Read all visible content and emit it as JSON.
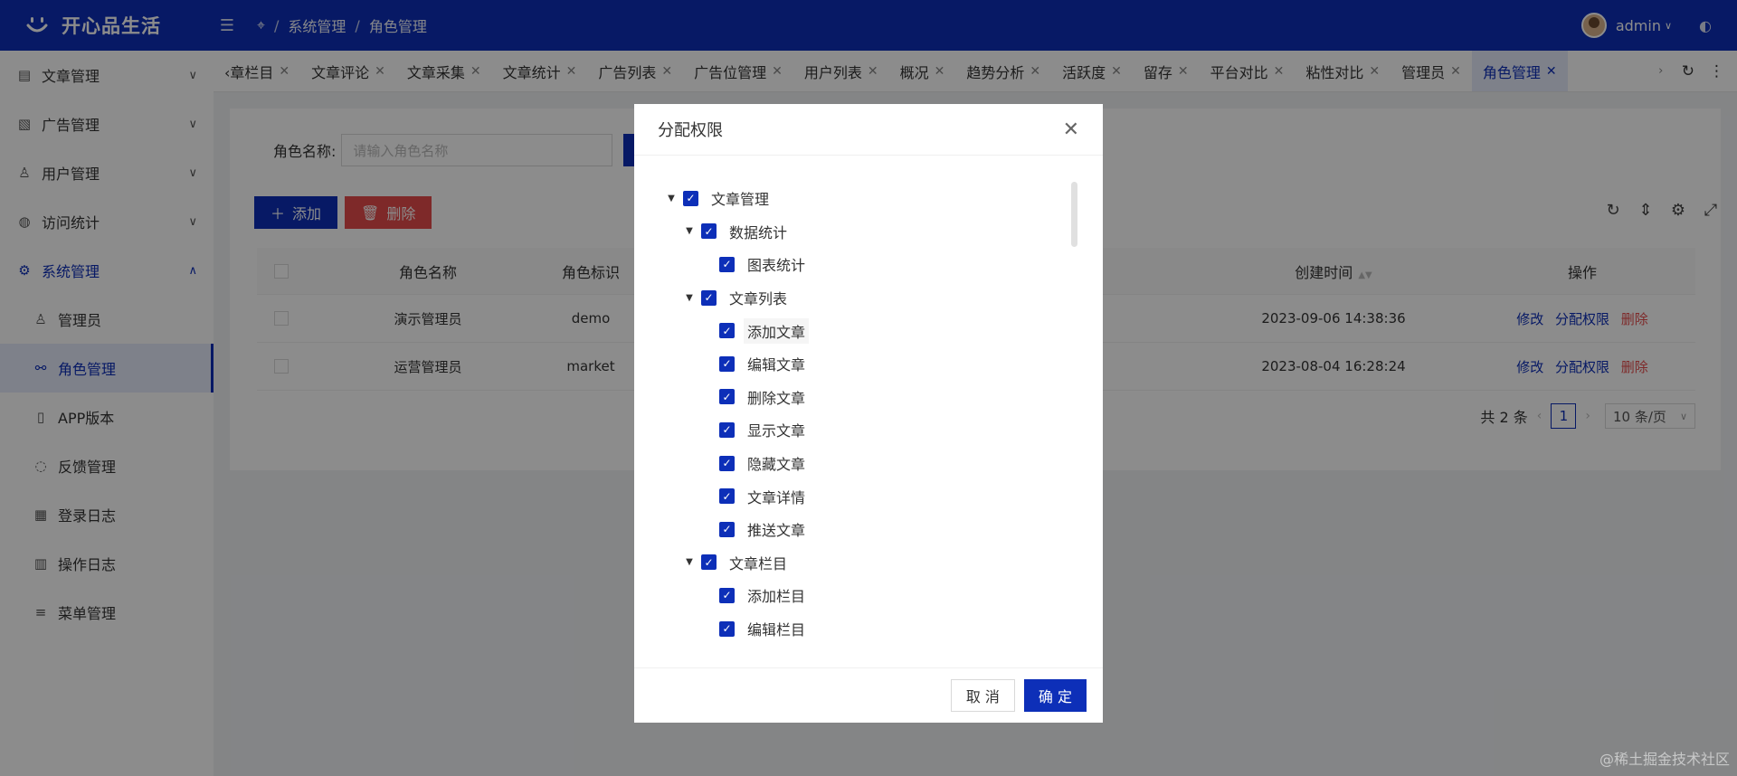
{
  "app": {
    "title": "开心品生活"
  },
  "breadcrumb": [
    "系统管理",
    "角色管理"
  ],
  "user": {
    "name": "admin"
  },
  "sidebar": {
    "items": [
      {
        "label": "文章管理",
        "icon": "document-icon"
      },
      {
        "label": "广告管理",
        "icon": "image-icon"
      },
      {
        "label": "用户管理",
        "icon": "user-icon"
      },
      {
        "label": "访问统计",
        "icon": "stats-icon"
      },
      {
        "label": "系统管理",
        "icon": "gear-icon"
      }
    ],
    "sub_items": [
      {
        "label": "管理员",
        "icon": "user-icon"
      },
      {
        "label": "角色管理",
        "icon": "roles-icon"
      },
      {
        "label": "APP版本",
        "icon": "phone-icon"
      },
      {
        "label": "反馈管理",
        "icon": "chat-icon"
      },
      {
        "label": "登录日志",
        "icon": "calendar-icon"
      },
      {
        "label": "操作日志",
        "icon": "log-icon"
      },
      {
        "label": "菜单管理",
        "icon": "menu-icon"
      }
    ]
  },
  "tabs": [
    "‹章栏目",
    "文章评论",
    "文章采集",
    "文章统计",
    "广告列表",
    "广告位管理",
    "用户列表",
    "概况",
    "趋势分析",
    "活跃度",
    "留存",
    "平台对比",
    "粘性对比",
    "管理员",
    "角色管理"
  ],
  "search": {
    "label": "角色名称:",
    "placeholder": "请输入角色名称"
  },
  "buttons": {
    "add": "添加",
    "delete": "删除"
  },
  "table": {
    "headers": {
      "name": "角色名称",
      "key": "角色标识",
      "created": "创建时间",
      "actions": "操作"
    },
    "rows": [
      {
        "name": "演示管理员",
        "key": "demo",
        "created": "2023-09-06 14:38:36"
      },
      {
        "name": "运营管理员",
        "key": "market",
        "created": "2023-08-04 16:28:24"
      }
    ],
    "row_actions": {
      "edit": "修改",
      "assign": "分配权限",
      "delete": "删除"
    }
  },
  "pagination": {
    "total": "共 2 条",
    "current": "1",
    "page_size": "10 条/页"
  },
  "modal": {
    "title": "分配权限",
    "tree": [
      {
        "label": "文章管理",
        "level": 0,
        "expandable": true
      },
      {
        "label": "数据统计",
        "level": 1,
        "expandable": true
      },
      {
        "label": "图表统计",
        "level": 2,
        "expandable": false
      },
      {
        "label": "文章列表",
        "level": 1,
        "expandable": true
      },
      {
        "label": "添加文章",
        "level": 2,
        "expandable": false
      },
      {
        "label": "编辑文章",
        "level": 2,
        "expandable": false
      },
      {
        "label": "删除文章",
        "level": 2,
        "expandable": false
      },
      {
        "label": "显示文章",
        "level": 2,
        "expandable": false
      },
      {
        "label": "隐藏文章",
        "level": 2,
        "expandable": false
      },
      {
        "label": "文章详情",
        "level": 2,
        "expandable": false
      },
      {
        "label": "推送文章",
        "level": 2,
        "expandable": false
      },
      {
        "label": "文章栏目",
        "level": 1,
        "expandable": true
      },
      {
        "label": "添加栏目",
        "level": 2,
        "expandable": false
      },
      {
        "label": "编辑栏目",
        "level": 2,
        "expandable": false
      }
    ],
    "cancel": "取 消",
    "confirm": "确 定"
  },
  "watermark": "@稀土掘金技术社区",
  "colors": {
    "primary": "#0d2fb8",
    "danger": "#e54b4b"
  }
}
